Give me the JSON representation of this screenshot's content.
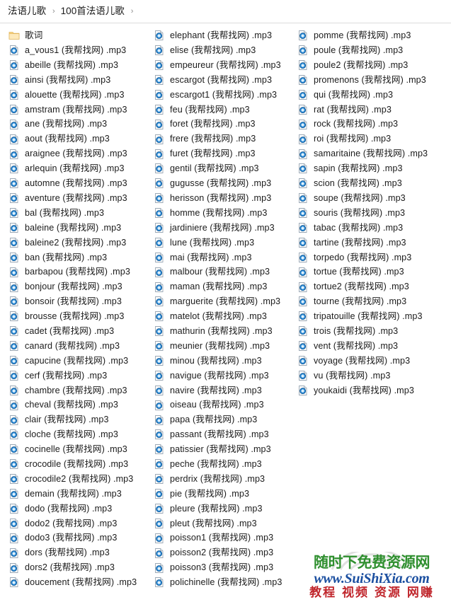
{
  "breadcrumb": {
    "separator": "›",
    "items": [
      {
        "label": "法语儿歌"
      },
      {
        "label": "100首法语儿歌"
      }
    ]
  },
  "icons": {
    "folder": "folder-icon",
    "mp3": "mp3-file-icon"
  },
  "columns": [
    {
      "id": "column-1",
      "items": [
        {
          "name": "歌词",
          "icon": "folder-icon"
        },
        {
          "name": "a_vous1 (我帮找网) .mp3",
          "icon": "mp3-file-icon"
        },
        {
          "name": "abeille (我帮找网) .mp3",
          "icon": "mp3-file-icon"
        },
        {
          "name": "ainsi (我帮找网) .mp3",
          "icon": "mp3-file-icon"
        },
        {
          "name": "alouette (我帮找网) .mp3",
          "icon": "mp3-file-icon"
        },
        {
          "name": "amstram (我帮找网) .mp3",
          "icon": "mp3-file-icon"
        },
        {
          "name": "ane (我帮找网) .mp3",
          "icon": "mp3-file-icon"
        },
        {
          "name": "aout (我帮找网) .mp3",
          "icon": "mp3-file-icon"
        },
        {
          "name": "araignee (我帮找网) .mp3",
          "icon": "mp3-file-icon"
        },
        {
          "name": "arlequin (我帮找网) .mp3",
          "icon": "mp3-file-icon"
        },
        {
          "name": "automne (我帮找网) .mp3",
          "icon": "mp3-file-icon"
        },
        {
          "name": "aventure (我帮找网) .mp3",
          "icon": "mp3-file-icon"
        },
        {
          "name": "bal (我帮找网) .mp3",
          "icon": "mp3-file-icon"
        },
        {
          "name": "baleine (我帮找网) .mp3",
          "icon": "mp3-file-icon"
        },
        {
          "name": "baleine2 (我帮找网) .mp3",
          "icon": "mp3-file-icon"
        },
        {
          "name": "ban (我帮找网) .mp3",
          "icon": "mp3-file-icon"
        },
        {
          "name": "barbapou (我帮找网) .mp3",
          "icon": "mp3-file-icon"
        },
        {
          "name": "bonjour (我帮找网) .mp3",
          "icon": "mp3-file-icon"
        },
        {
          "name": "bonsoir (我帮找网) .mp3",
          "icon": "mp3-file-icon"
        },
        {
          "name": "brousse (我帮找网) .mp3",
          "icon": "mp3-file-icon"
        },
        {
          "name": "cadet (我帮找网) .mp3",
          "icon": "mp3-file-icon"
        },
        {
          "name": "canard (我帮找网) .mp3",
          "icon": "mp3-file-icon"
        },
        {
          "name": "capucine (我帮找网) .mp3",
          "icon": "mp3-file-icon"
        },
        {
          "name": "cerf (我帮找网) .mp3",
          "icon": "mp3-file-icon"
        },
        {
          "name": "chambre (我帮找网) .mp3",
          "icon": "mp3-file-icon"
        },
        {
          "name": "cheval (我帮找网) .mp3",
          "icon": "mp3-file-icon"
        },
        {
          "name": "clair (我帮找网) .mp3",
          "icon": "mp3-file-icon"
        },
        {
          "name": "cloche (我帮找网) .mp3",
          "icon": "mp3-file-icon"
        },
        {
          "name": "cocinelle (我帮找网) .mp3",
          "icon": "mp3-file-icon"
        },
        {
          "name": "crocodile (我帮找网) .mp3",
          "icon": "mp3-file-icon"
        },
        {
          "name": "crocodile2 (我帮找网) .mp3",
          "icon": "mp3-file-icon"
        },
        {
          "name": "demain (我帮找网) .mp3",
          "icon": "mp3-file-icon"
        },
        {
          "name": "dodo (我帮找网) .mp3",
          "icon": "mp3-file-icon"
        },
        {
          "name": "dodo2 (我帮找网) .mp3",
          "icon": "mp3-file-icon"
        },
        {
          "name": "dodo3 (我帮找网) .mp3",
          "icon": "mp3-file-icon"
        },
        {
          "name": "dors (我帮找网) .mp3",
          "icon": "mp3-file-icon"
        },
        {
          "name": "dors2 (我帮找网) .mp3",
          "icon": "mp3-file-icon"
        },
        {
          "name": "doucement (我帮找网) .mp3",
          "icon": "mp3-file-icon"
        }
      ]
    },
    {
      "id": "column-2",
      "items": [
        {
          "name": "elephant (我帮找网) .mp3",
          "icon": "mp3-file-icon"
        },
        {
          "name": "elise (我帮找网) .mp3",
          "icon": "mp3-file-icon"
        },
        {
          "name": "empeureur (我帮找网) .mp3",
          "icon": "mp3-file-icon"
        },
        {
          "name": "escargot (我帮找网) .mp3",
          "icon": "mp3-file-icon"
        },
        {
          "name": "escargot1 (我帮找网) .mp3",
          "icon": "mp3-file-icon"
        },
        {
          "name": "feu (我帮找网) .mp3",
          "icon": "mp3-file-icon"
        },
        {
          "name": "foret (我帮找网) .mp3",
          "icon": "mp3-file-icon"
        },
        {
          "name": "frere (我帮找网) .mp3",
          "icon": "mp3-file-icon"
        },
        {
          "name": "furet (我帮找网) .mp3",
          "icon": "mp3-file-icon"
        },
        {
          "name": "gentil (我帮找网) .mp3",
          "icon": "mp3-file-icon"
        },
        {
          "name": "gugusse (我帮找网) .mp3",
          "icon": "mp3-file-icon"
        },
        {
          "name": "herisson (我帮找网) .mp3",
          "icon": "mp3-file-icon"
        },
        {
          "name": "homme (我帮找网) .mp3",
          "icon": "mp3-file-icon"
        },
        {
          "name": "jardiniere (我帮找网) .mp3",
          "icon": "mp3-file-icon"
        },
        {
          "name": "lune (我帮找网) .mp3",
          "icon": "mp3-file-icon"
        },
        {
          "name": "mai (我帮找网) .mp3",
          "icon": "mp3-file-icon"
        },
        {
          "name": "malbour (我帮找网) .mp3",
          "icon": "mp3-file-icon"
        },
        {
          "name": "maman (我帮找网) .mp3",
          "icon": "mp3-file-icon"
        },
        {
          "name": "marguerite (我帮找网) .mp3",
          "icon": "mp3-file-icon"
        },
        {
          "name": "matelot (我帮找网) .mp3",
          "icon": "mp3-file-icon"
        },
        {
          "name": "mathurin (我帮找网) .mp3",
          "icon": "mp3-file-icon"
        },
        {
          "name": "meunier (我帮找网) .mp3",
          "icon": "mp3-file-icon"
        },
        {
          "name": "minou (我帮找网) .mp3",
          "icon": "mp3-file-icon"
        },
        {
          "name": "navigue (我帮找网) .mp3",
          "icon": "mp3-file-icon"
        },
        {
          "name": "navire (我帮找网) .mp3",
          "icon": "mp3-file-icon"
        },
        {
          "name": "oiseau (我帮找网) .mp3",
          "icon": "mp3-file-icon"
        },
        {
          "name": "papa (我帮找网) .mp3",
          "icon": "mp3-file-icon"
        },
        {
          "name": "passant (我帮找网) .mp3",
          "icon": "mp3-file-icon"
        },
        {
          "name": "patissier (我帮找网) .mp3",
          "icon": "mp3-file-icon"
        },
        {
          "name": "peche (我帮找网) .mp3",
          "icon": "mp3-file-icon"
        },
        {
          "name": "perdrix (我帮找网) .mp3",
          "icon": "mp3-file-icon"
        },
        {
          "name": "pie (我帮找网) .mp3",
          "icon": "mp3-file-icon"
        },
        {
          "name": "pleure (我帮找网) .mp3",
          "icon": "mp3-file-icon"
        },
        {
          "name": "pleut (我帮找网) .mp3",
          "icon": "mp3-file-icon"
        },
        {
          "name": "poisson1 (我帮找网) .mp3",
          "icon": "mp3-file-icon"
        },
        {
          "name": "poisson2 (我帮找网) .mp3",
          "icon": "mp3-file-icon"
        },
        {
          "name": "poisson3 (我帮找网) .mp3",
          "icon": "mp3-file-icon"
        },
        {
          "name": "polichinelle (我帮找网) .mp3",
          "icon": "mp3-file-icon"
        }
      ]
    },
    {
      "id": "column-3",
      "items": [
        {
          "name": "pomme (我帮找网) .mp3",
          "icon": "mp3-file-icon"
        },
        {
          "name": "poule (我帮找网) .mp3",
          "icon": "mp3-file-icon"
        },
        {
          "name": "poule2 (我帮找网) .mp3",
          "icon": "mp3-file-icon"
        },
        {
          "name": "promenons (我帮找网) .mp3",
          "icon": "mp3-file-icon"
        },
        {
          "name": "qui (我帮找网) .mp3",
          "icon": "mp3-file-icon"
        },
        {
          "name": "rat (我帮找网) .mp3",
          "icon": "mp3-file-icon"
        },
        {
          "name": "rock (我帮找网) .mp3",
          "icon": "mp3-file-icon"
        },
        {
          "name": "roi (我帮找网) .mp3",
          "icon": "mp3-file-icon"
        },
        {
          "name": "samaritaine (我帮找网) .mp3",
          "icon": "mp3-file-icon"
        },
        {
          "name": "sapin (我帮找网) .mp3",
          "icon": "mp3-file-icon"
        },
        {
          "name": "scion (我帮找网) .mp3",
          "icon": "mp3-file-icon"
        },
        {
          "name": "soupe (我帮找网) .mp3",
          "icon": "mp3-file-icon"
        },
        {
          "name": "souris (我帮找网) .mp3",
          "icon": "mp3-file-icon"
        },
        {
          "name": "tabac (我帮找网) .mp3",
          "icon": "mp3-file-icon"
        },
        {
          "name": "tartine (我帮找网) .mp3",
          "icon": "mp3-file-icon"
        },
        {
          "name": "torpedo (我帮找网) .mp3",
          "icon": "mp3-file-icon"
        },
        {
          "name": "tortue (我帮找网) .mp3",
          "icon": "mp3-file-icon"
        },
        {
          "name": "tortue2 (我帮找网) .mp3",
          "icon": "mp3-file-icon"
        },
        {
          "name": "tourne (我帮找网) .mp3",
          "icon": "mp3-file-icon"
        },
        {
          "name": "tripatouille (我帮找网) .mp3",
          "icon": "mp3-file-icon"
        },
        {
          "name": "trois (我帮找网) .mp3",
          "icon": "mp3-file-icon"
        },
        {
          "name": "vent (我帮找网) .mp3",
          "icon": "mp3-file-icon"
        },
        {
          "name": "voyage (我帮找网) .mp3",
          "icon": "mp3-file-icon"
        },
        {
          "name": "vu (我帮找网) .mp3",
          "icon": "mp3-file-icon"
        },
        {
          "name": "youkaidi (我帮找网) .mp3",
          "icon": "mp3-file-icon"
        }
      ]
    }
  ],
  "watermark": {
    "line1": "随时下免费资源网",
    "line2": "www.SuiShiXia.com",
    "line3": "教程 视频 资源 网赚",
    "colors": {
      "line1": "#2f8f2f",
      "line2": "#1b4fa0",
      "line3": "#c0272d"
    }
  }
}
